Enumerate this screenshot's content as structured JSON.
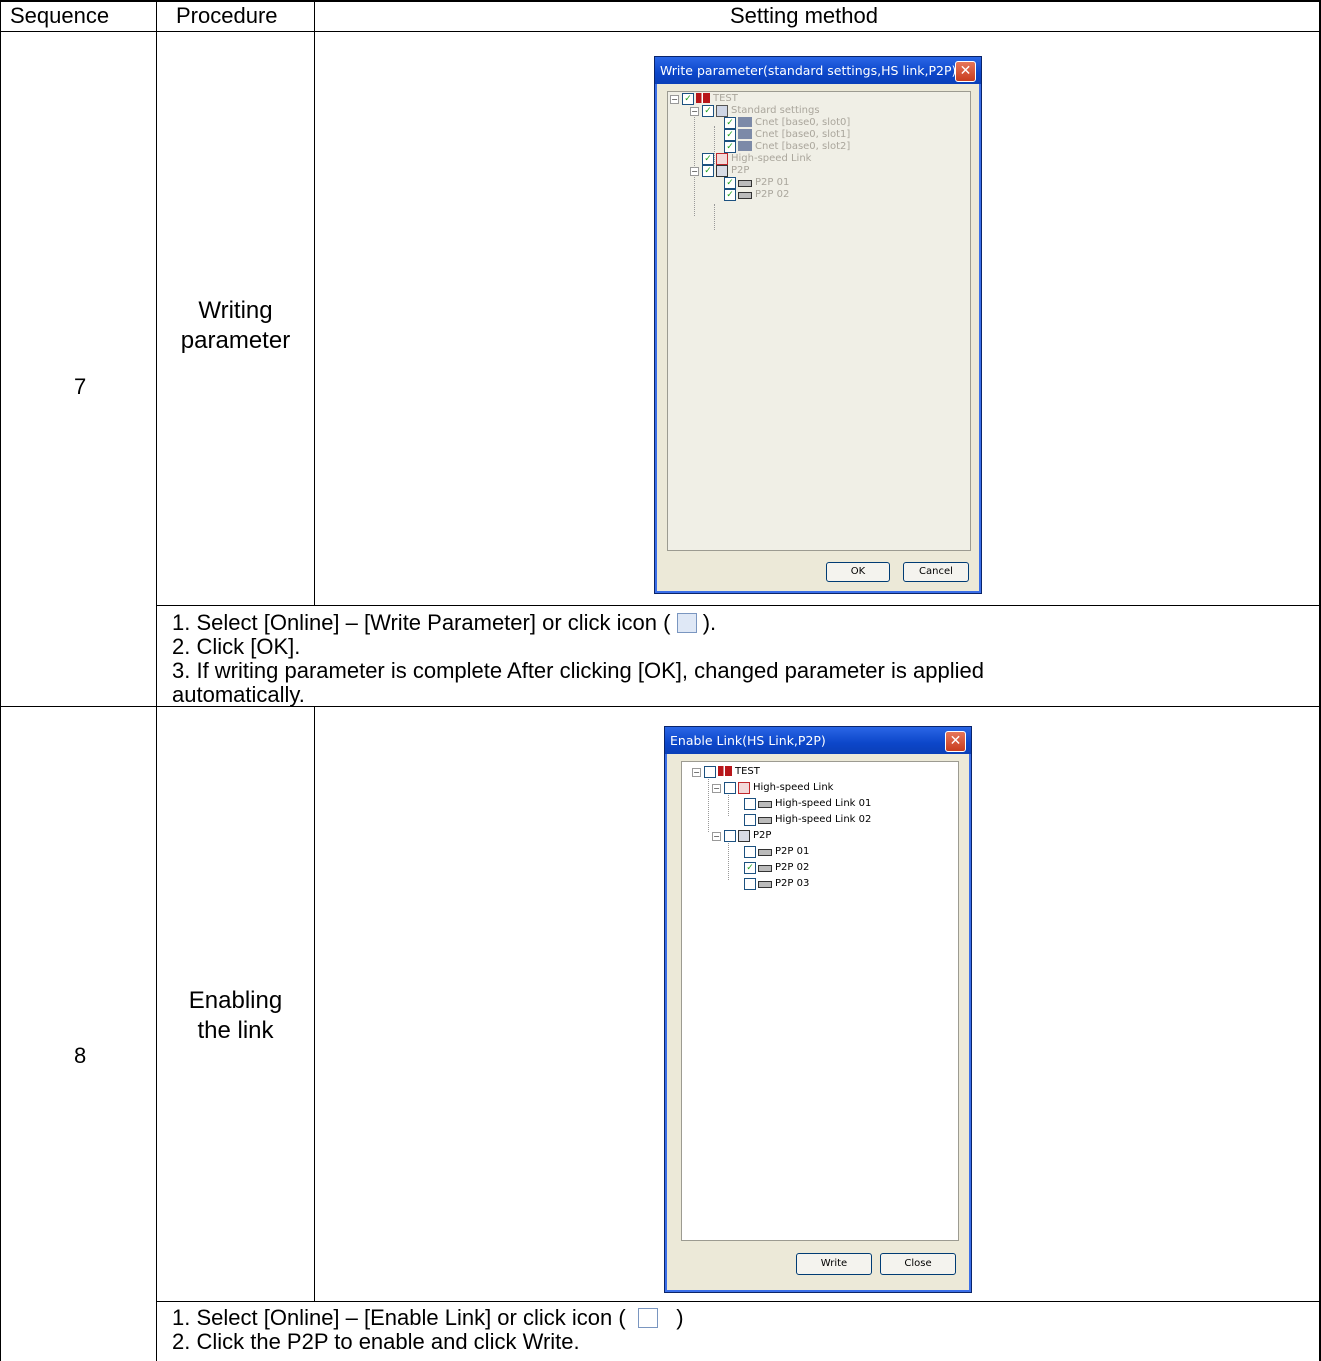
{
  "header": {
    "sequence": "Sequence",
    "procedure": "Procedure",
    "setting_method": "Setting method"
  },
  "rows": [
    {
      "sequence": "7",
      "procedure_line1": "Writing",
      "procedure_line2": "parameter",
      "dialog": {
        "title": "Write parameter(standard settings,HS link,P2P)",
        "tree": [
          "TEST",
          "Standard settings",
          "Cnet [base0, slot0]",
          "Cnet [base0, slot1]",
          "Cnet [base0, slot2]",
          "High-speed Link",
          "P2P",
          "P2P 01",
          "P2P 02"
        ],
        "ok": "OK",
        "cancel": "Cancel"
      },
      "instructions": {
        "line1_pre": "1. Select [Online] – [Write Parameter] or click icon (",
        "line1_post": ").",
        "line2": "2. Click [OK].",
        "line3": "3. If writing parameter is complete After clicking [OK], changed parameter is applied",
        "line4": "automatically."
      }
    },
    {
      "sequence": "8",
      "procedure_line1": "Enabling",
      "procedure_line2": "the link",
      "dialog": {
        "title": "Enable Link(HS Link,P2P)",
        "tree": [
          "TEST",
          "High-speed Link",
          "High-speed Link 01",
          "High-speed Link 02",
          "P2P",
          "P2P 01",
          "P2P 02",
          "P2P 03"
        ],
        "write": "Write",
        "close": "Close"
      },
      "instructions": {
        "line1_pre": "1. Select [Online] – [Enable Link] or click icon (",
        "line1_post": ")",
        "line2": "2. Click the P2P to enable and click Write."
      }
    }
  ]
}
